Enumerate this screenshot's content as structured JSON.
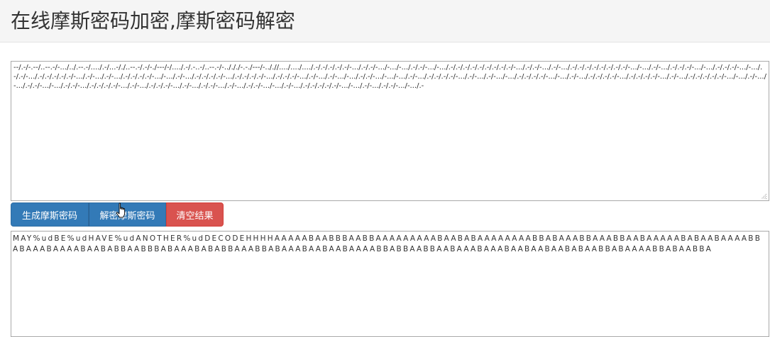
{
  "header": {
    "title": "在线摩斯密码加密,摩斯密码解密"
  },
  "input": {
    "value": "--/.-/-.--/..--.-/-.../../.--.-/..../.-/...-/./..--.-/.-/-./---/-/..../.-/.-..-/..--.-/-../././-.-./---/-.././/..../..../..../.-/.-/.-/.-/.-/-.../.-/.-/-.../-.../-.../.-/.-/-.../-.../.-/.-/.-/.-/.-/.-/.-/.-/.-/-.../.-/.-/-.../.-/-.../.-/.-/.-/.-/.-/.-/.-/.-/-.../-.../.-/-.../.-/.-/.-/-.../-.../.-/.-/.-/-.../-.../.-/.-/-.../.-/.-/.-/.-/.-/-.../.-/-.../.-/-.../.-/.-/.-/.-/-.../-.../.-/-.../.-/.-/.-/.-/-.../.-/.-/.-/.-/-.../.-/.-/.-/-.../.-/-.../.-/-.../-.../.-/.-/-.../-.../-.../.-/-.../.-/.-/.-/.-/-.../.-/-.../.-/-.../-.../.-/.-/.-/.-/-.../-.../.-/-.../.-/.-/.-/.-/-.../.-/.-/.-/.-/-.../.-/-.../.-/.-/.-/.-/.-/-.../-.../.-/-.../-.../.-/.-/-.../-.../.-/.-/-.../.-/.-/.-/.-/-.../.-/-.../.-/.-/.-/-.../.-/-.../.-/.-/-.../.-/-.../.-/.-/-.../-.../.-/-.../.-/.-/.-/.-/.-/-.../-.../.-/-.../.-/.-/-.../-.../.-"
  },
  "buttons": {
    "encrypt_label": "生成摩斯密码",
    "decrypt_label": "解密摩斯密码",
    "clear_label": "清空结果"
  },
  "output": {
    "value": "MAY%udBE%udHAVE%udANOTHER%udDECODEHHHHAAAAABAABBBAABBAAAAAAAAABAABABAAAAAAAABBABAAABBAAABBAABAAAAABABAABAAAABBABAAABAAAABAABABBAABBBABAAABABABBAAABBABAAABAABAABAAAABBABBAABBAABAAABAAABAABAABAABABAABBABAAAABBABAABBA"
  },
  "colors": {
    "primary": "#337ab7",
    "danger": "#d9534f",
    "header_bg": "#f5f5f5"
  },
  "icons": {
    "cursor": "hand-pointer-icon",
    "resize": "resize-grip-icon"
  }
}
